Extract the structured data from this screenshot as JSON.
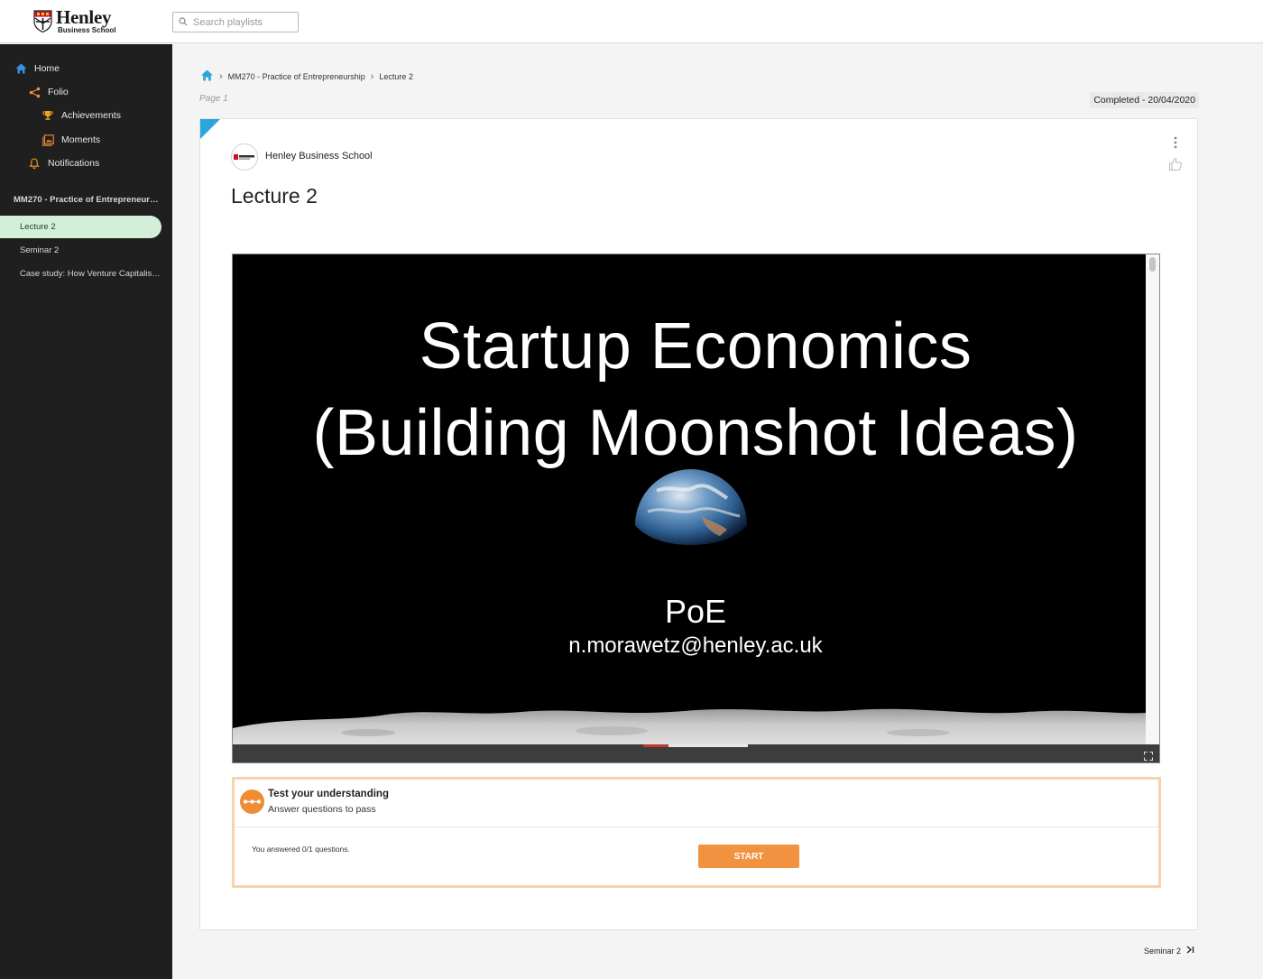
{
  "header": {
    "logo_main": "Henley",
    "logo_sub": "Business School",
    "search_placeholder": "Search playlists"
  },
  "sidebar": {
    "nav": [
      {
        "label": "Home",
        "icon": "home-icon"
      },
      {
        "label": "Folio",
        "icon": "share-icon"
      },
      {
        "label": "Achievements",
        "icon": "trophy-icon"
      },
      {
        "label": "Moments",
        "icon": "gallery-icon"
      },
      {
        "label": "Notifications",
        "icon": "bell-icon"
      }
    ],
    "course_title": "MM270 - Practice of Entrepreneurship",
    "lessons": [
      {
        "label": "Lecture 2",
        "active": true
      },
      {
        "label": "Seminar 2",
        "active": false
      },
      {
        "label": "Case study: How Venture Capitalists Make Decisions",
        "active": false
      }
    ]
  },
  "breadcrumb": {
    "items": [
      "MM270 - Practice of Entrepreneurship",
      "Lecture 2"
    ]
  },
  "page_label": "Page 1",
  "completed": "Completed - 20/04/2020",
  "card": {
    "org_name": "Henley Business School",
    "title": "Lecture 2"
  },
  "slide": {
    "title_line1": "Startup Economics",
    "title_line2": "(Building Moonshot Ideas)",
    "subtitle": "PoE",
    "email": "n.morawetz@henley.ac.uk",
    "progress": 0.24
  },
  "quiz": {
    "title": "Test your understanding",
    "subtitle": "Answer questions to pass",
    "status": "You answered 0/1 questions.",
    "button": "START"
  },
  "next_item": "Seminar 2",
  "colors": {
    "accent": "#2aa6da",
    "active_lesson_bg": "#d3eed9",
    "quiz_orange": "#f09240",
    "quiz_border": "#f5d3ad",
    "sidebar_bg": "#1f1f1f"
  }
}
